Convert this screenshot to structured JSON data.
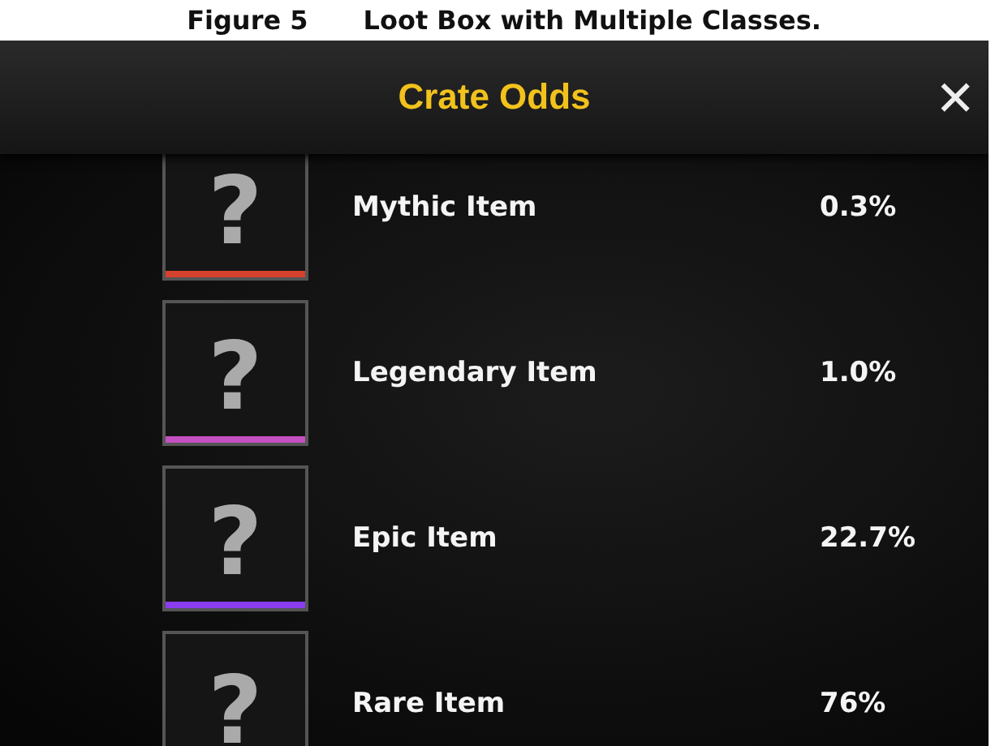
{
  "caption": {
    "label": "Figure 5",
    "text": "Loot Box with Multiple Classes."
  },
  "window": {
    "title": "Crate Odds",
    "close": "✕"
  },
  "items": [
    {
      "glyph": "?",
      "name": "Mythic Item",
      "odds": "0.3%",
      "color": "#d4412c"
    },
    {
      "glyph": "?",
      "name": "Legendary Item",
      "odds": "1.0%",
      "color": "#c44fc0"
    },
    {
      "glyph": "?",
      "name": "Epic Item",
      "odds": "22.7%",
      "color": "#8a3cef"
    },
    {
      "glyph": "?",
      "name": "Rare Item",
      "odds": "76%"
    }
  ]
}
